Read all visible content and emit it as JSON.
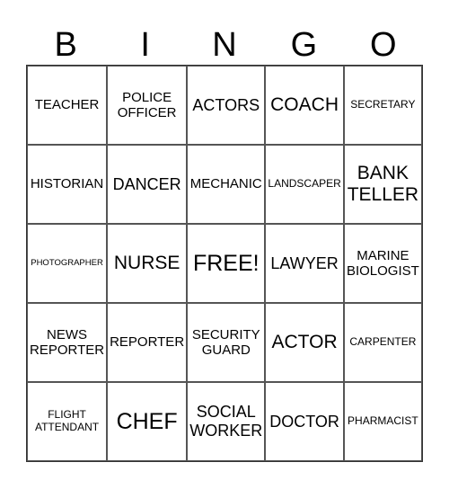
{
  "header": [
    "B",
    "I",
    "N",
    "G",
    "O"
  ],
  "cells": [
    {
      "text": "TEACHER",
      "size": "md"
    },
    {
      "text": "POLICE OFFICER",
      "size": "md"
    },
    {
      "text": "ACTORS",
      "size": "lg"
    },
    {
      "text": "COACH",
      "size": "xl"
    },
    {
      "text": "SECRETARY",
      "size": "sm"
    },
    {
      "text": "HISTORIAN",
      "size": "md"
    },
    {
      "text": "DANCER",
      "size": "lg"
    },
    {
      "text": "MECHANIC",
      "size": "md"
    },
    {
      "text": "LANDSCAPER",
      "size": "sm"
    },
    {
      "text": "BANK TELLER",
      "size": "xl"
    },
    {
      "text": "PHOTOGRAPHER",
      "size": "xs"
    },
    {
      "text": "NURSE",
      "size": "xl"
    },
    {
      "text": "FREE!",
      "size": "xxl"
    },
    {
      "text": "LAWYER",
      "size": "lg"
    },
    {
      "text": "MARINE BIOLOGIST",
      "size": "md"
    },
    {
      "text": "NEWS REPORTER",
      "size": "md"
    },
    {
      "text": "REPORTER",
      "size": "md"
    },
    {
      "text": "SECURITY GUARD",
      "size": "md"
    },
    {
      "text": "ACTOR",
      "size": "xl"
    },
    {
      "text": "CARPENTER",
      "size": "sm"
    },
    {
      "text": "FLIGHT ATTENDANT",
      "size": "sm"
    },
    {
      "text": "CHEF",
      "size": "xxl"
    },
    {
      "text": "SOCIAL WORKER",
      "size": "lg"
    },
    {
      "text": "DOCTOR",
      "size": "lg"
    },
    {
      "text": "PHARMACIST",
      "size": "sm"
    }
  ]
}
